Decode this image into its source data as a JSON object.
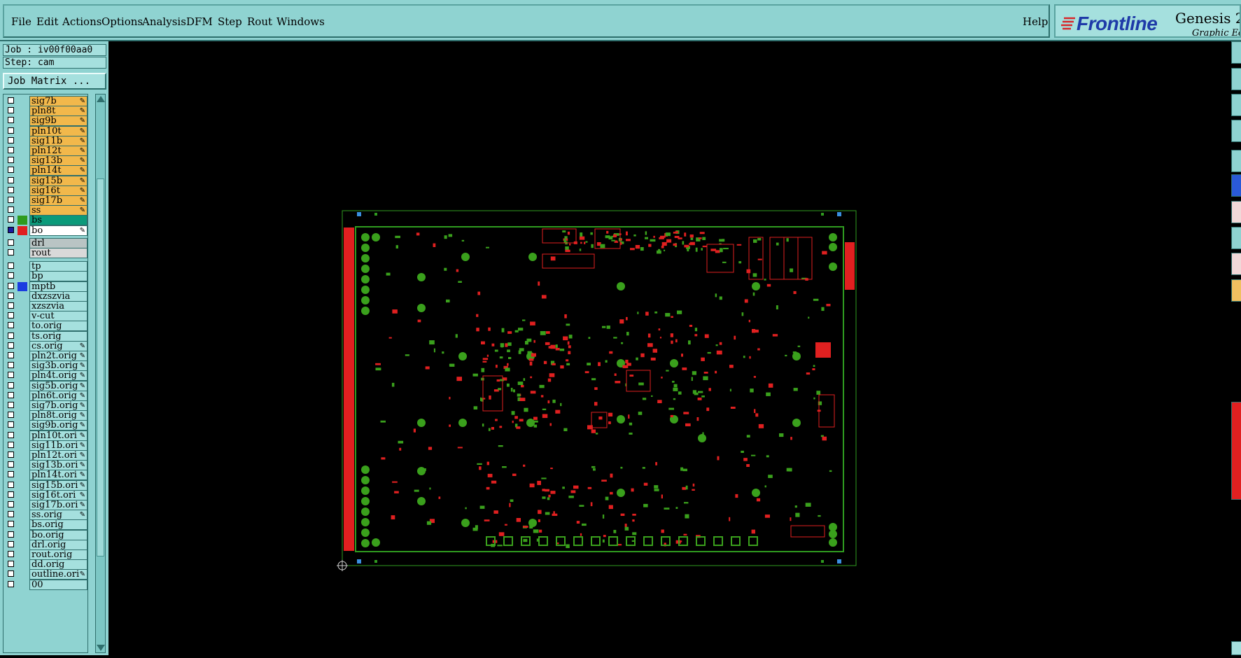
{
  "menubar": {
    "items": [
      "File",
      "Edit",
      "Actions",
      "Options",
      "Analysis",
      "DFM",
      "Step",
      "Rout",
      "Windows"
    ],
    "help": "Help"
  },
  "brand": {
    "logo": "Frontline",
    "product": "Genesis 2",
    "subtitle": "Graphic Edi"
  },
  "job": {
    "label": "Job : iv00f00aa0",
    "step": "Step: cam"
  },
  "job_matrix_button": "Job Matrix ...",
  "layers_group1": [
    {
      "name": "sig7b",
      "color": "#f2b84b",
      "edit": true,
      "checked": false
    },
    {
      "name": "pln8t",
      "color": "#f2b84b",
      "edit": true,
      "checked": false
    },
    {
      "name": "sig9b",
      "color": "#f2b84b",
      "edit": true,
      "checked": false
    },
    {
      "name": "pln10t",
      "color": "#f2b84b",
      "edit": true,
      "checked": false
    },
    {
      "name": "sig11b",
      "color": "#f2b84b",
      "edit": true,
      "checked": false
    },
    {
      "name": "pln12t",
      "color": "#f2b84b",
      "edit": true,
      "checked": false
    },
    {
      "name": "sig13b",
      "color": "#f2b84b",
      "edit": true,
      "checked": false
    },
    {
      "name": "pln14t",
      "color": "#f2b84b",
      "edit": true,
      "checked": false
    },
    {
      "name": "sig15b",
      "color": "#f2b84b",
      "edit": true,
      "checked": false
    },
    {
      "name": "sig16t",
      "color": "#f2b84b",
      "edit": true,
      "checked": false
    },
    {
      "name": "sig17b",
      "color": "#f2b84b",
      "edit": true,
      "checked": false
    },
    {
      "name": "ss",
      "color": "#f2b84b",
      "edit": true,
      "checked": false
    },
    {
      "name": "bs",
      "color": "#0b9a7a",
      "swatch": "#2f9b1f",
      "edit": false,
      "checked": false
    },
    {
      "name": "bo",
      "color": "#ffffff",
      "swatch": "#e02020",
      "edit": true,
      "checked": true
    }
  ],
  "layers_group2": [
    {
      "name": "drl",
      "color": "#b9c4c4",
      "checked": false
    },
    {
      "name": "rout",
      "color": "#d9d9d9",
      "checked": false
    }
  ],
  "layers_group3": [
    {
      "name": "tp",
      "edit": false,
      "checked": false
    },
    {
      "name": "bp",
      "edit": false,
      "checked": false
    },
    {
      "name": "mptb",
      "swatch": "#1a3de0",
      "edit": false,
      "checked": false
    },
    {
      "name": "dxzszvia",
      "edit": false,
      "checked": false
    },
    {
      "name": "xzszvia",
      "edit": false,
      "checked": false
    },
    {
      "name": "v-cut",
      "edit": false,
      "checked": false
    },
    {
      "name": "to.orig",
      "edit": false,
      "checked": false
    },
    {
      "name": "ts.orig",
      "edit": false,
      "checked": false
    },
    {
      "name": "cs.orig",
      "edit": true,
      "checked": false
    },
    {
      "name": "pln2t.orig",
      "edit": true,
      "checked": false
    },
    {
      "name": "sig3b.orig",
      "edit": true,
      "checked": false
    },
    {
      "name": "pln4t.orig",
      "edit": true,
      "checked": false
    },
    {
      "name": "sig5b.orig",
      "edit": true,
      "checked": false
    },
    {
      "name": "pln6t.orig",
      "edit": true,
      "checked": false
    },
    {
      "name": "sig7b.orig",
      "edit": true,
      "checked": false
    },
    {
      "name": "pln8t.orig",
      "edit": true,
      "checked": false
    },
    {
      "name": "sig9b.orig",
      "edit": true,
      "checked": false
    },
    {
      "name": "pln10t.ori",
      "edit": true,
      "checked": false
    },
    {
      "name": "sig11b.ori",
      "edit": true,
      "checked": false
    },
    {
      "name": "pln12t.ori",
      "edit": true,
      "checked": false
    },
    {
      "name": "sig13b.ori",
      "edit": true,
      "checked": false
    },
    {
      "name": "pln14t.ori",
      "edit": true,
      "checked": false
    },
    {
      "name": "sig15b.ori",
      "edit": true,
      "checked": false
    },
    {
      "name": "sig16t.ori",
      "edit": true,
      "checked": false
    },
    {
      "name": "sig17b.ori",
      "edit": true,
      "checked": false
    },
    {
      "name": "ss.orig",
      "edit": true,
      "checked": false
    },
    {
      "name": "bs.orig",
      "edit": false,
      "checked": false
    },
    {
      "name": "bo.orig",
      "edit": false,
      "checked": false
    },
    {
      "name": "drl.orig",
      "edit": false,
      "checked": false
    },
    {
      "name": "rout.orig",
      "edit": false,
      "checked": false
    },
    {
      "name": "dd.orig",
      "edit": false,
      "checked": false
    },
    {
      "name": "outline.ori",
      "edit": true,
      "checked": false
    },
    {
      "name": "00",
      "edit": false,
      "checked": false
    }
  ],
  "colors": {
    "ui_bg": "#8fd3d1",
    "canvas_bg": "#000000",
    "board_outline": "#2f9b1f",
    "features": "#e02020",
    "pads_green": "#3aa01c",
    "selected_marker": "#3a8fe0"
  }
}
